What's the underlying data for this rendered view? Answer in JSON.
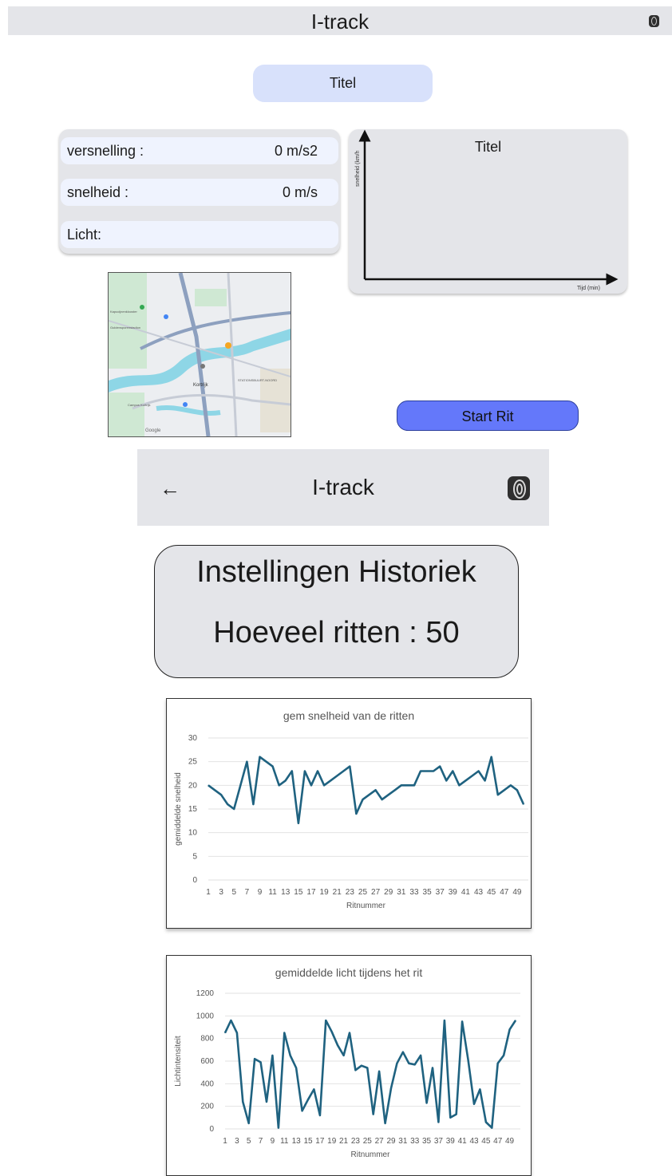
{
  "app_bar": {
    "title": "I-track"
  },
  "card_title_button": "Titel",
  "sensors": {
    "acceleration_label": "versnelling :",
    "acceleration_value": "0 m/s2",
    "speed_label": "snelheid :",
    "speed_value": "0 m/s",
    "light_label": "Licht:"
  },
  "speed_chart": {
    "title": "Titel",
    "ylabel": "snelheid (km/h",
    "xlabel": "Tijd (min)"
  },
  "map": {
    "labels": [
      "Kortrijk",
      "STATIONSBUURT-NOORD",
      "Campus Kortrijk",
      "Google",
      "Guldensporenstadion",
      "Kapucijnenklooster"
    ]
  },
  "start_button": "Start Rit",
  "history_header": {
    "back_icon": "arrow-left-icon",
    "title": "I-track",
    "fingerprint_icon": "fingerprint-icon"
  },
  "settings": {
    "heading": "Instellingen Historiek",
    "count_text": "Hoeveel ritten : 50"
  },
  "chart_data": [
    {
      "type": "line",
      "title": "gem snelheid van de ritten",
      "xlabel": "Ritnummer",
      "ylabel": "gemiddelde snelheid",
      "ylim": [
        0,
        30
      ],
      "yticks": [
        0,
        5,
        10,
        15,
        20,
        25,
        30
      ],
      "xtick_labels": [
        "1",
        "3",
        "5",
        "7",
        "9",
        "11",
        "13",
        "15",
        "17",
        "19",
        "21",
        "23",
        "25",
        "27",
        "29",
        "31",
        "33",
        "35",
        "37",
        "39",
        "41",
        "43",
        "45",
        "47",
        "49"
      ],
      "x": [
        1,
        2,
        3,
        4,
        5,
        6,
        7,
        8,
        9,
        10,
        11,
        12,
        13,
        14,
        15,
        16,
        17,
        18,
        19,
        20,
        21,
        22,
        23,
        24,
        25,
        26,
        27,
        28,
        29,
        30,
        31,
        32,
        33,
        34,
        35,
        36,
        37,
        38,
        39,
        40,
        41,
        42,
        43,
        44,
        45,
        46,
        47,
        48,
        49,
        50
      ],
      "values": [
        20,
        19,
        18,
        16,
        15,
        20,
        25,
        16,
        26,
        25,
        24,
        20,
        21,
        23,
        12,
        23,
        20,
        23,
        20,
        21,
        22,
        23,
        24,
        14,
        17,
        18,
        19,
        17,
        18,
        19,
        20,
        20,
        20,
        23,
        23,
        23,
        24,
        21,
        23,
        20,
        21,
        22,
        23,
        21,
        26,
        18,
        19,
        20,
        19,
        16
      ],
      "color": "#1f6280",
      "grid": true
    },
    {
      "type": "line",
      "title": "gemiddelde licht tijdens het rit",
      "xlabel": "Ritnummer",
      "ylabel": "Lichtintensiteit",
      "ylim": [
        0,
        1200
      ],
      "yticks": [
        0,
        200,
        400,
        600,
        800,
        1000,
        1200
      ],
      "xtick_labels": [
        "1",
        "3",
        "5",
        "7",
        "9",
        "11",
        "13",
        "15",
        "17",
        "19",
        "21",
        "23",
        "25",
        "27",
        "29",
        "31",
        "33",
        "35",
        "37",
        "39",
        "41",
        "43",
        "45",
        "47",
        "49"
      ],
      "x": [
        1,
        2,
        3,
        4,
        5,
        6,
        7,
        8,
        9,
        10,
        11,
        12,
        13,
        14,
        15,
        16,
        17,
        18,
        19,
        20,
        21,
        22,
        23,
        24,
        25,
        26,
        27,
        28,
        29,
        30,
        31,
        32,
        33,
        34,
        35,
        36,
        37,
        38,
        39,
        40,
        41,
        42,
        43,
        44,
        45,
        46,
        47,
        48,
        49,
        50
      ],
      "values": [
        850,
        960,
        850,
        240,
        50,
        620,
        590,
        240,
        650,
        10,
        850,
        650,
        540,
        160,
        260,
        350,
        120,
        960,
        860,
        740,
        650,
        850,
        520,
        560,
        540,
        130,
        510,
        50,
        360,
        580,
        680,
        580,
        570,
        650,
        230,
        540,
        60,
        960,
        100,
        130,
        950,
        610,
        220,
        350,
        60,
        10,
        580,
        650,
        880,
        960
      ],
      "color": "#1f6280",
      "grid": true
    }
  ]
}
